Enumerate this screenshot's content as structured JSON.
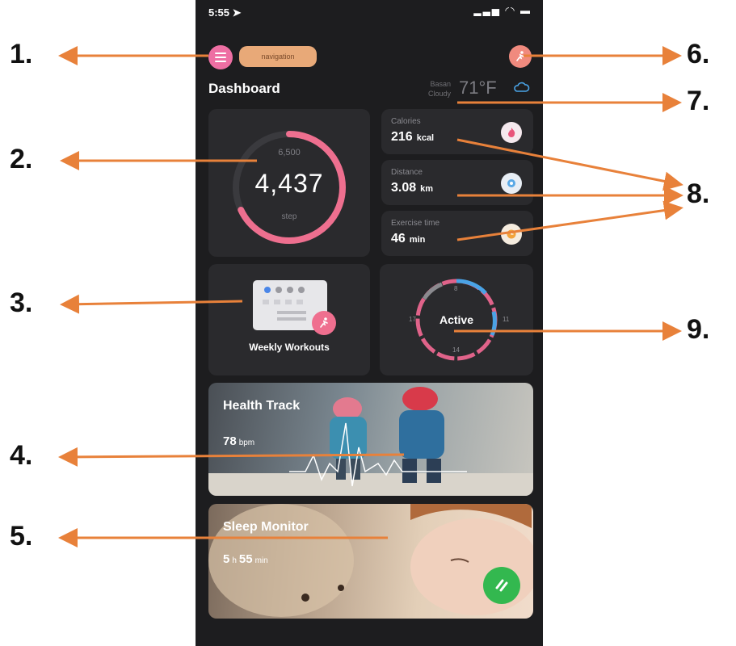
{
  "status_bar": {
    "time": "5:55 ➤",
    "icons": "▂▃▅ ◜◝ ▬"
  },
  "header": {
    "menu_icon": "menu-icon",
    "nav_chip": "navigation",
    "profile_icon": "runner-icon"
  },
  "dashboard": {
    "title": "Dashboard"
  },
  "weather": {
    "city": "Basan",
    "condition": "Cloudy",
    "temp": "71°F",
    "icon": "cloud-icon"
  },
  "steps": {
    "goal": "6,500",
    "value": "4,437",
    "unit": "step",
    "progress": 0.68
  },
  "metrics": [
    {
      "label": "Calories",
      "value": "216",
      "unit": "kcal",
      "icon": "flame-icon",
      "color": "#e8537a"
    },
    {
      "label": "Distance",
      "value": "3.08",
      "unit": "km",
      "icon": "location-icon",
      "color": "#5aa9e6"
    },
    {
      "label": "Exercise time",
      "value": "46",
      "unit": "min",
      "icon": "clock-icon",
      "color": "#f2a33a"
    }
  ],
  "workouts": {
    "label": "Weekly Workouts"
  },
  "activity": {
    "label": "Active",
    "ticks": [
      "8",
      "11",
      "14",
      "17"
    ]
  },
  "health_track": {
    "title": "Health Track",
    "value": "78",
    "unit": "bpm"
  },
  "sleep_monitor": {
    "title": "Sleep Monitor",
    "hours": "5",
    "h_unit": "h",
    "minutes": "55",
    "m_unit": "min"
  },
  "callouts": [
    "1.",
    "2.",
    "3.",
    "4.",
    "5.",
    "6.",
    "7.",
    "8.",
    "9."
  ],
  "colors": {
    "accent_pink": "#ee6f8f",
    "arrow": "#e8813a",
    "card": "#2a2a2d",
    "bg": "#1d1d1f"
  }
}
